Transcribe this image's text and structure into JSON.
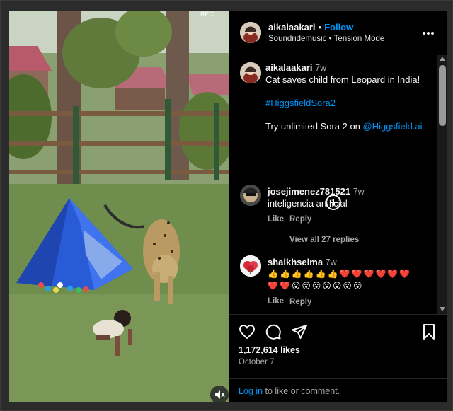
{
  "video": {
    "watermark_text": "REC",
    "mute_icon": "speaker-muted-icon"
  },
  "header": {
    "username": "aikalaakari",
    "dot": "•",
    "follow_label": "Follow",
    "music": "Soundridemusic • Tension Mode",
    "more_icon": "more-horizontal-icon"
  },
  "caption": {
    "username": "aikalaakari",
    "time": "7w",
    "line1": "Cat saves child from Leopard in India!",
    "hashtag": "#HiggsfieldSora2",
    "try_text": "Try unlimited Sora 2 on ",
    "mention": "@Higgsfield.ai"
  },
  "comments": [
    {
      "username": "josejimenez781521",
      "time": "7w",
      "text": "inteligencia artificial",
      "like_label": "Like",
      "reply_label": "Reply",
      "view_replies": "View all 27 replies"
    },
    {
      "username": "shaikhselma",
      "time": "7w",
      "text_line1": "👍👍👍👍👍👍❤️❤️❤️❤️❤️❤️",
      "text_line2": "❤️❤️😮😮😮😮😮😮😮",
      "like_label": "Like",
      "reply_label": "Reply"
    }
  ],
  "actions": {
    "like_icon": "heart-icon",
    "comment_icon": "comment-icon",
    "share_icon": "send-icon",
    "save_icon": "bookmark-icon",
    "likes": "1,172,614 likes",
    "date": "October 7",
    "login_link": "Log in",
    "login_rest": " to like or comment."
  },
  "colors": {
    "accent": "#0095f6",
    "panel_bg": "#000000",
    "secondary_text": "#a8a8a8"
  }
}
